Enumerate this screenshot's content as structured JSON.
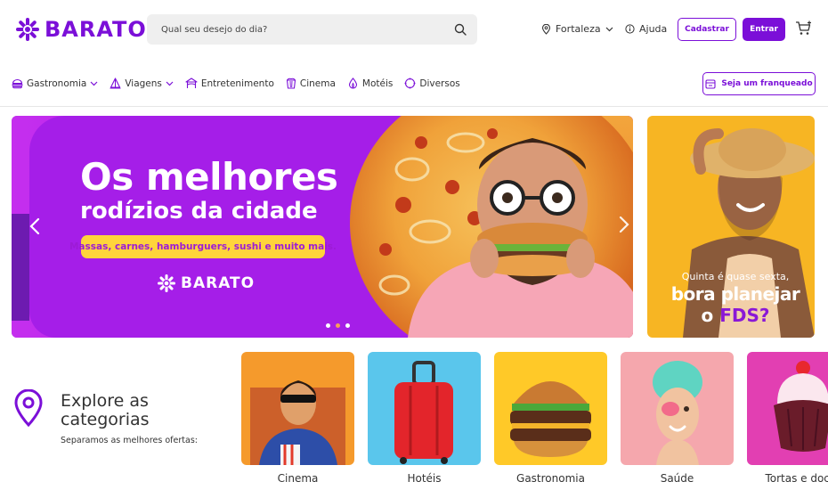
{
  "header": {
    "logo_text": "BARATO",
    "search_placeholder": "Qual seu desejo do dia?",
    "city": "Fortaleza",
    "help": "Ajuda",
    "signup": "Cadastrar",
    "login": "Entrar"
  },
  "nav": {
    "items": [
      {
        "label": "Gastronomia",
        "icon": "food-icon",
        "dropdown": true
      },
      {
        "label": "Viagens",
        "icon": "travel-icon",
        "dropdown": true
      },
      {
        "label": "Entretenimento",
        "icon": "entertainment-icon",
        "dropdown": false
      },
      {
        "label": "Cinema",
        "icon": "cinema-icon",
        "dropdown": false
      },
      {
        "label": "Motéis",
        "icon": "motel-icon",
        "dropdown": false
      },
      {
        "label": "Diversos",
        "icon": "misc-icon",
        "dropdown": false
      }
    ],
    "franchise": "Seja um franqueado"
  },
  "banner": {
    "headline1": "Os melhores",
    "headline2": "rodízios da cidade",
    "tag": "Massas, carnes, hamburguers, sushi e muito mais.",
    "logo_text": "BARATO",
    "slides": 3,
    "active_slide": 2
  },
  "promo": {
    "line1": "Quinta é quase sexta,",
    "line2": "bora planejar",
    "line3_prefix": "o ",
    "line3_highlight": "FDS?"
  },
  "explore": {
    "title": "Explore as categorias",
    "subtitle": "Separamos as melhores ofertas:"
  },
  "categories": [
    {
      "label": "Cinema",
      "bg": "#f59a2c"
    },
    {
      "label": "Hotéis",
      "bg": "#5ac6ec"
    },
    {
      "label": "Gastronomia",
      "bg": "#ffc928"
    },
    {
      "label": "Saúde",
      "bg": "#f5a7ad"
    },
    {
      "label": "Tortas e doces",
      "bg": "#e23fb2"
    }
  ],
  "colors": {
    "brand": "#7b0fd8",
    "banner": "#a51ee8",
    "tag": "#ffd43b",
    "promo": "#f7b523"
  }
}
